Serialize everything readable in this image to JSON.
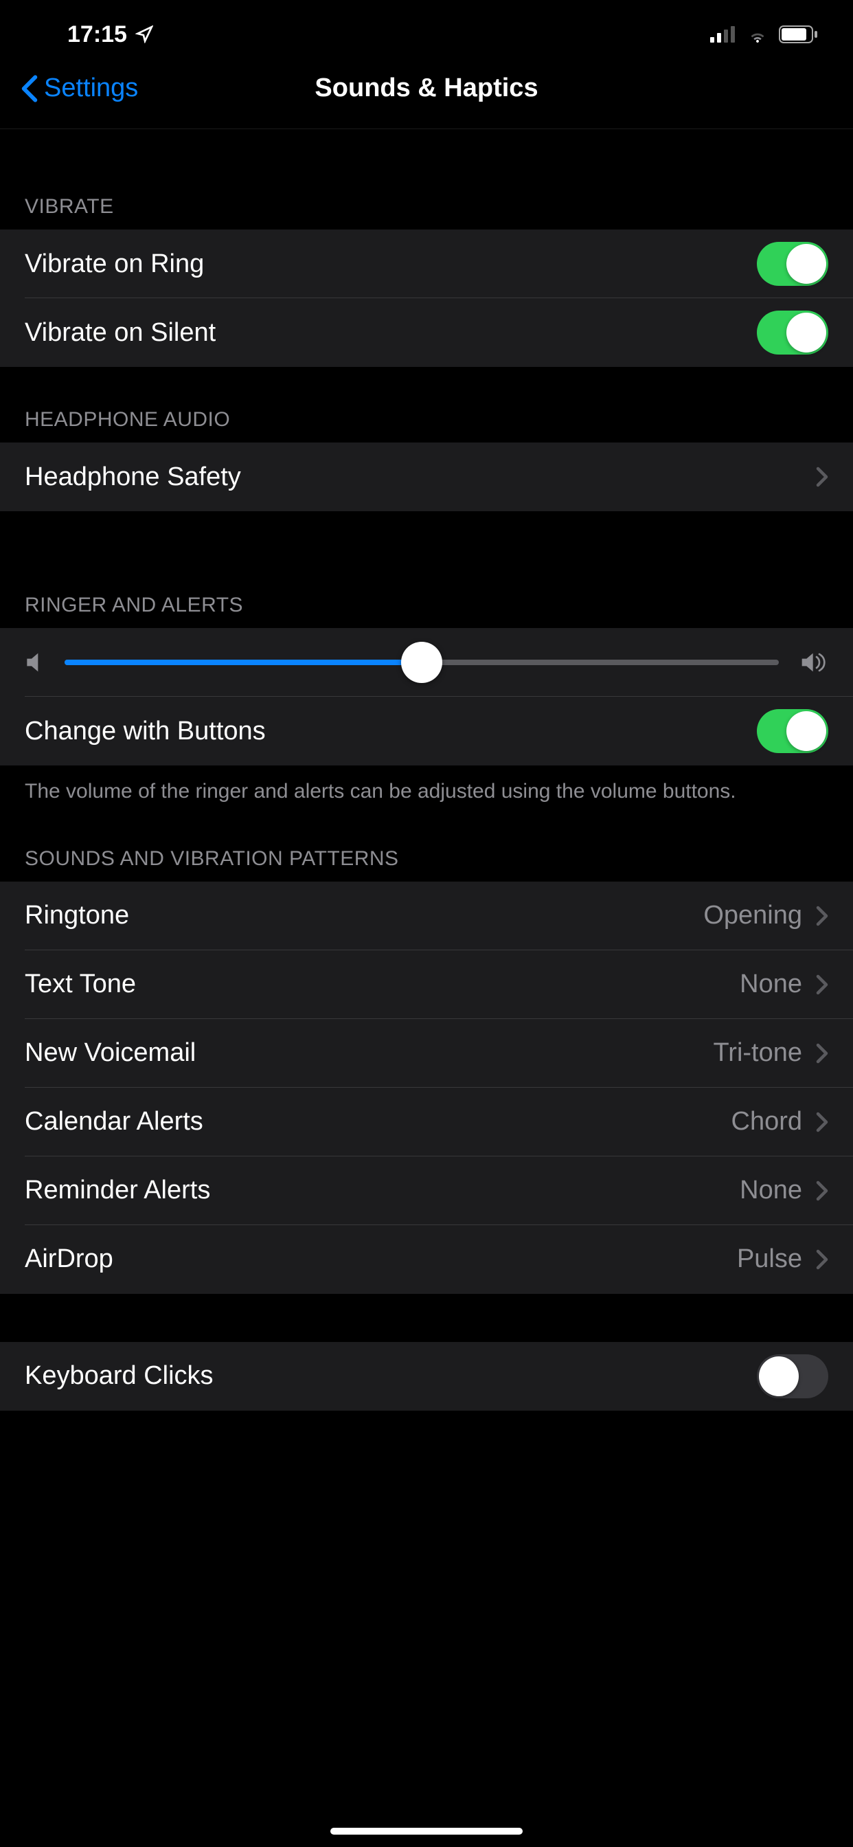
{
  "statusBar": {
    "time": "17:15"
  },
  "nav": {
    "back": "Settings",
    "title": "Sounds & Haptics"
  },
  "sections": {
    "vibrate": {
      "header": "VIBRATE",
      "items": [
        {
          "label": "Vibrate on Ring",
          "on": true
        },
        {
          "label": "Vibrate on Silent",
          "on": true
        }
      ]
    },
    "headphone": {
      "header": "HEADPHONE AUDIO",
      "items": [
        {
          "label": "Headphone Safety"
        }
      ]
    },
    "ringer": {
      "header": "RINGER AND ALERTS",
      "sliderValue": 50,
      "changeWithButtons": {
        "label": "Change with Buttons",
        "on": true
      },
      "footer": "The volume of the ringer and alerts can be adjusted using the volume buttons."
    },
    "sounds": {
      "header": "SOUNDS AND VIBRATION PATTERNS",
      "items": [
        {
          "label": "Ringtone",
          "value": "Opening"
        },
        {
          "label": "Text Tone",
          "value": "None"
        },
        {
          "label": "New Voicemail",
          "value": "Tri-tone"
        },
        {
          "label": "Calendar Alerts",
          "value": "Chord"
        },
        {
          "label": "Reminder Alerts",
          "value": "None"
        },
        {
          "label": "AirDrop",
          "value": "Pulse"
        }
      ]
    },
    "keyboard": {
      "items": [
        {
          "label": "Keyboard Clicks",
          "on": false
        }
      ]
    }
  }
}
